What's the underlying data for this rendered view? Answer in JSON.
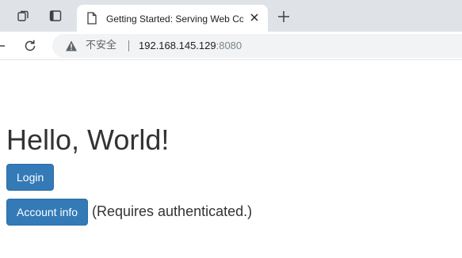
{
  "browser": {
    "tab": {
      "title": "Getting Started: Serving Web Content"
    },
    "address_bar": {
      "security_label": "不安全",
      "host": "192.168.145.129",
      "port": ":8080"
    },
    "icons": {
      "workspaces": "workspaces-icon",
      "tab_actions": "tab-actions-icon",
      "page": "document-icon",
      "close": "close-icon",
      "new_tab": "plus-icon",
      "back": "back-arrow-icon",
      "reload": "reload-icon",
      "warning": "warning-icon"
    }
  },
  "page": {
    "heading": "Hello, World!",
    "login_button": "Login",
    "account_button": "Account info",
    "requires_note": "(Requires authenticated.)"
  },
  "colors": {
    "primary_button": "#337ab7",
    "tab_strip": "#dfe3e8",
    "text": "#333333"
  }
}
